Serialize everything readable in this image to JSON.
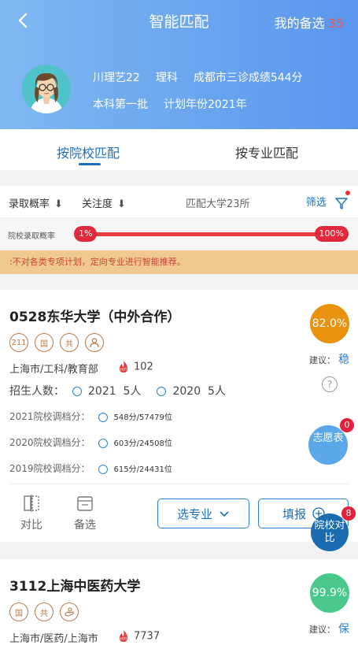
{
  "header": {
    "title": "智能匹配",
    "favorites_label": "我的备选",
    "favorites_count": "35",
    "user": {
      "name": "川理艺22",
      "subject": "理科",
      "score": "成都市三诊成绩544分",
      "batch": "本科第一批",
      "plan_year": "计划年份2021年"
    }
  },
  "tabs": [
    "按院校匹配",
    "按专业匹配"
  ],
  "filters": {
    "probability": "录取概率",
    "attention": "关注度",
    "match_count": "匹配大学23所",
    "filter": "筛选"
  },
  "prob_bar": {
    "label": "院校录取概率",
    "min": "1%",
    "max": "100%"
  },
  "notice": ":不对各类专项计划，定向专业进行智能推荐。",
  "cards": [
    {
      "name": "0528东华大学（中外合作）",
      "tags": [
        "211",
        "国",
        "共",
        "公"
      ],
      "location": "上海市/工科/教育部",
      "hot": "102",
      "probability": "82.0%",
      "suggest_label": "建议：",
      "suggest_value": "稳",
      "enroll_label": "招生人数：",
      "enroll": [
        {
          "year": "2021",
          "count": "5人"
        },
        {
          "year": "2020",
          "count": "5人"
        }
      ],
      "scores": [
        {
          "label": "2021院校调档分：",
          "value": "548分/57479位"
        },
        {
          "label": "2020院校调档分：",
          "value": "603分/24508位"
        },
        {
          "label": "2019院校调档分：",
          "value": "615分/24431位"
        }
      ]
    },
    {
      "name": "3112上海中医药大学",
      "tags": [
        "国",
        "共",
        "医"
      ],
      "location": "上海市/医药/上海市",
      "hot": "7737",
      "probability": "99.9%",
      "suggest_label": "建议：",
      "suggest_value": "保"
    }
  ],
  "actions": {
    "compare": "对比",
    "backup": "备选",
    "select_major": "选专业",
    "fill": "填报",
    "wish_table": "志愿表",
    "wish_count": "0",
    "school_compare": "院校对比",
    "compare_count": "8"
  },
  "colors": {
    "accent": "#1c6fb8",
    "prob_orange": "#e8920f",
    "prob_green": "#48c98b",
    "bar_red": "#e43c3c"
  }
}
